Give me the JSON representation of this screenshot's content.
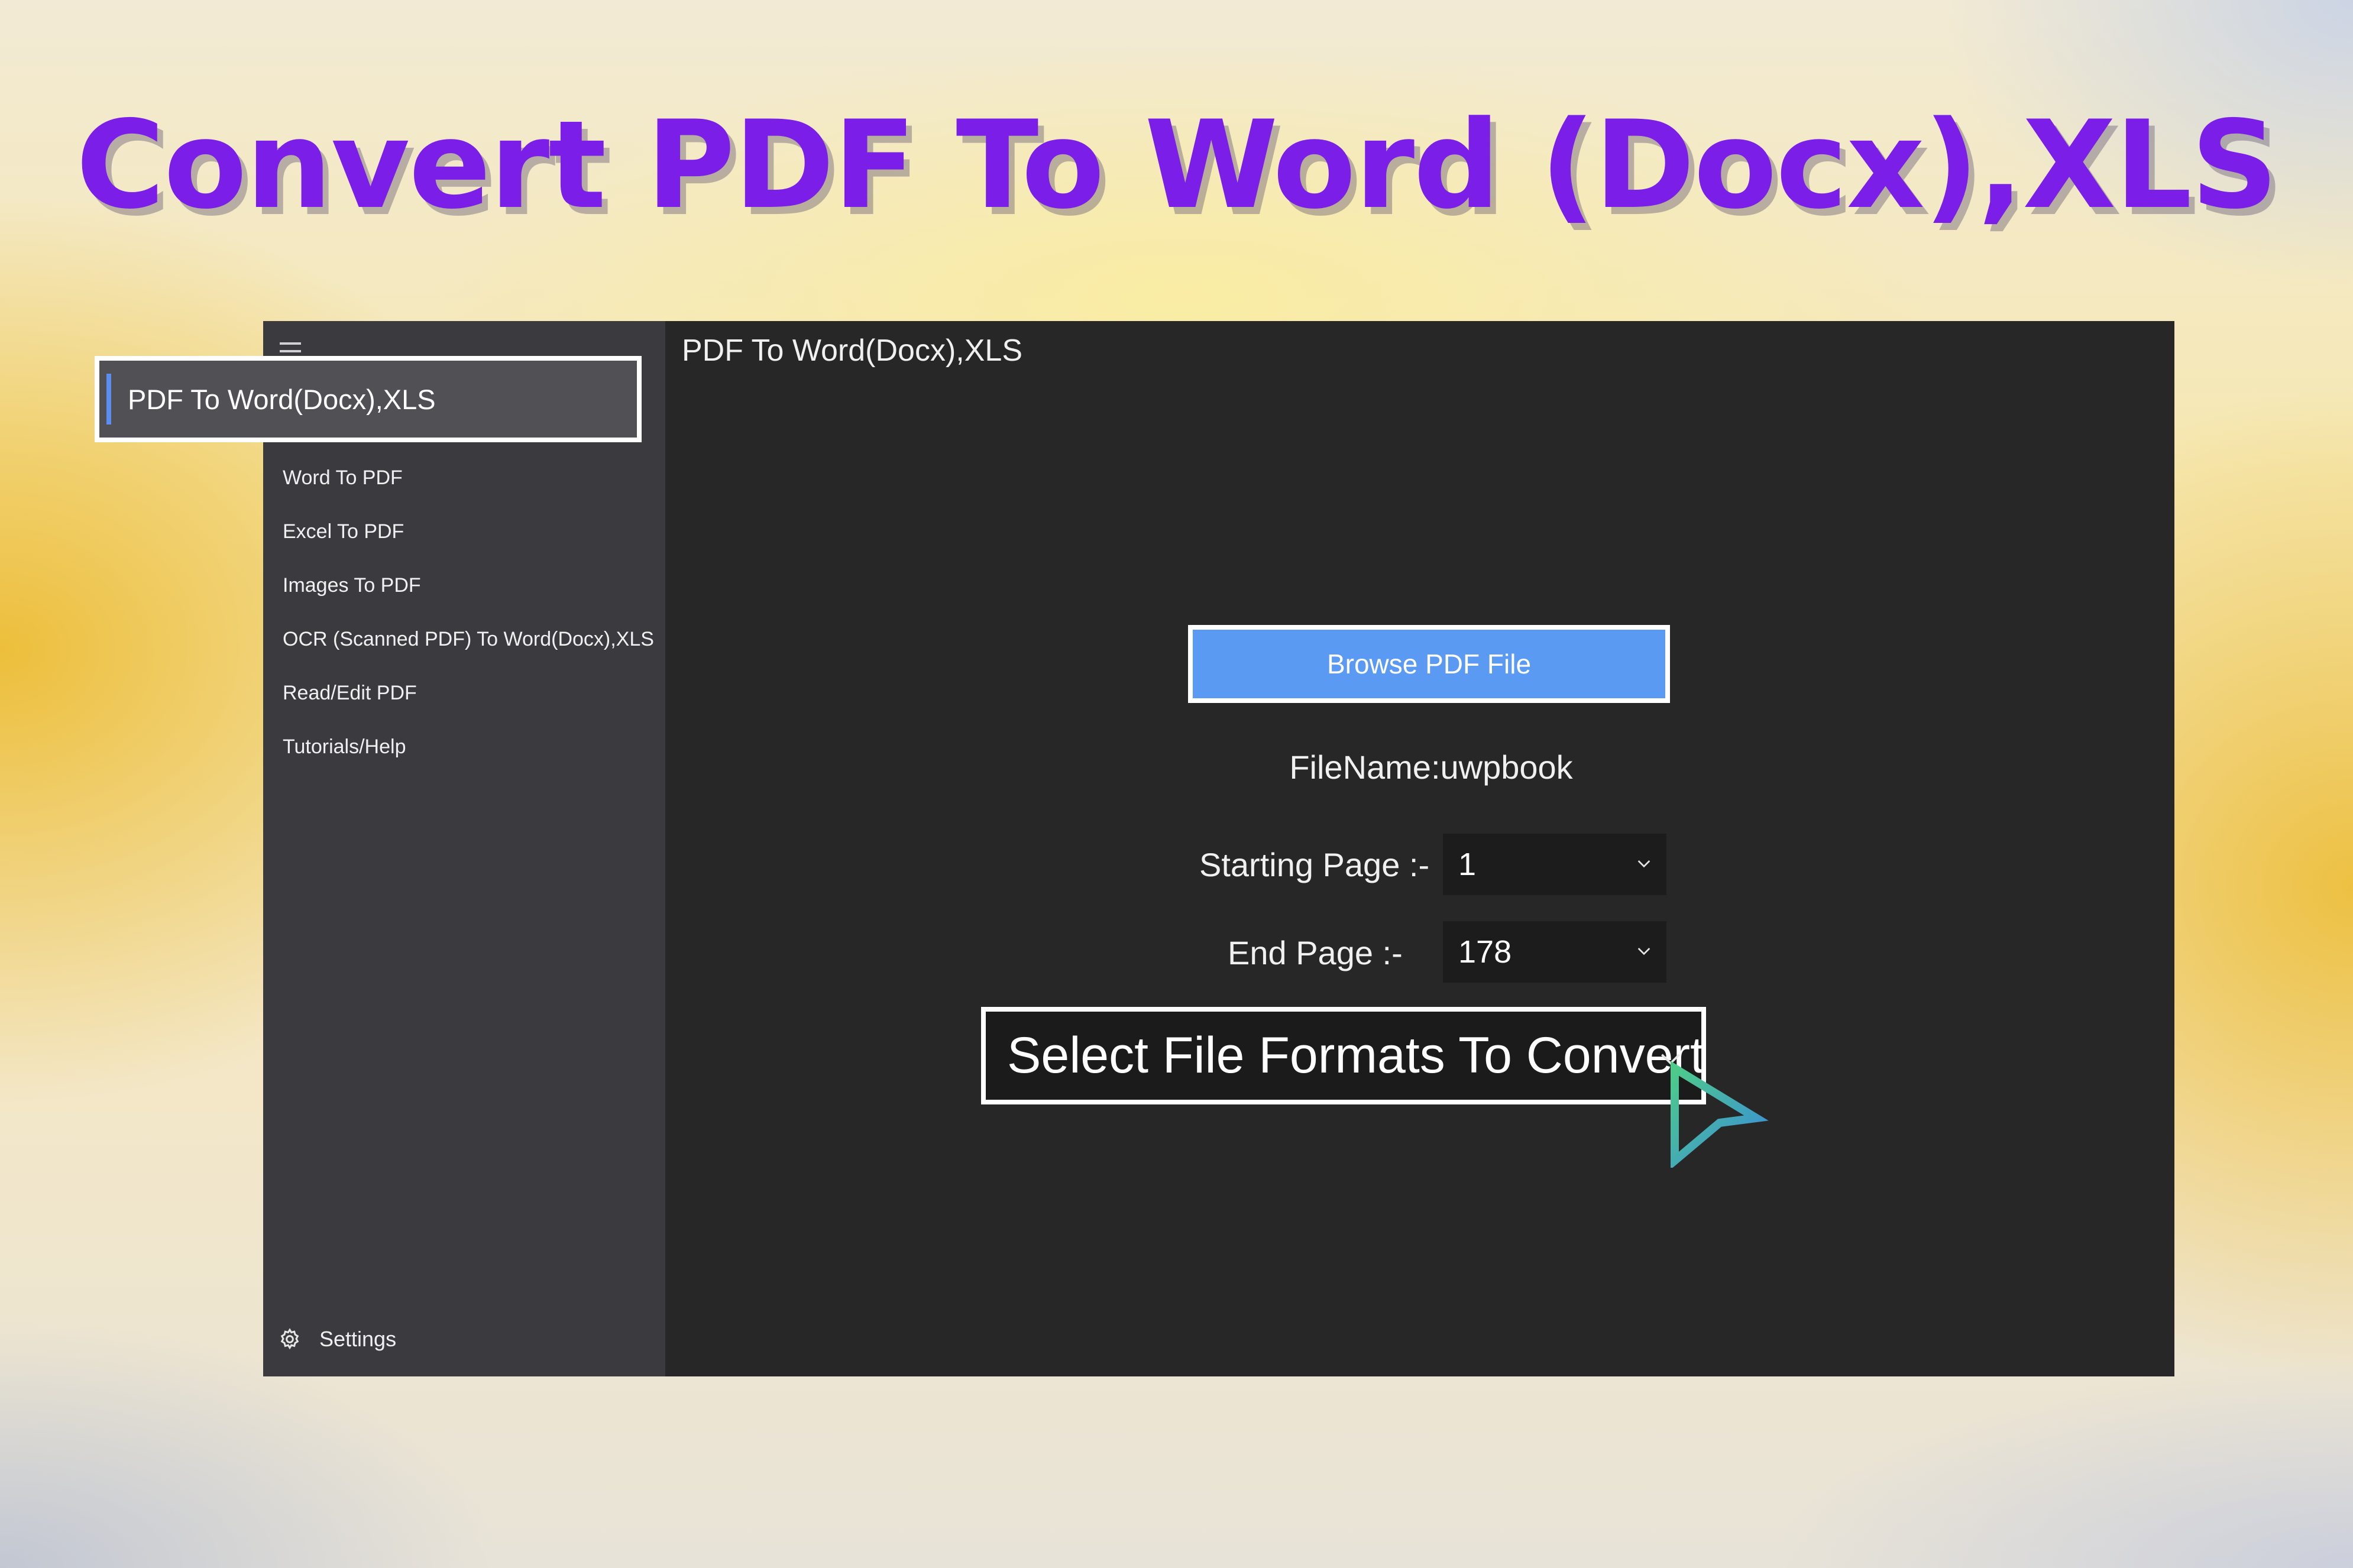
{
  "banner": {
    "title": "Convert PDF To Word (Docx),XLS"
  },
  "app": {
    "page_title": "PDF To Word(Docx),XLS",
    "sidebar": {
      "selected_item": "PDF To Word(Docx),XLS",
      "items": [
        {
          "label": "Word To PDF"
        },
        {
          "label": "Excel To PDF"
        },
        {
          "label": "Images To PDF"
        },
        {
          "label": "OCR (Scanned PDF) To Word(Docx),XLS"
        },
        {
          "label": "Read/Edit PDF"
        },
        {
          "label": "Tutorials/Help"
        }
      ],
      "settings_label": "Settings"
    },
    "main": {
      "browse_label": "Browse PDF File",
      "filename_text": "FileName:uwpbook",
      "starting_page_label": "Starting Page :-",
      "starting_page_value": "1",
      "end_page_label": "End Page :-",
      "end_page_value": "178",
      "format_select_label": "Select File Formats To Convert"
    }
  },
  "colors": {
    "title": "#7a1ee8",
    "accent_button": "#5b9af3",
    "window_bg": "#272727",
    "sidebar_bg": "#3b3b3f"
  },
  "icons": [
    "hamburger-menu-icon",
    "gear-icon",
    "chevron-down-icon",
    "mouse-cursor-icon"
  ]
}
